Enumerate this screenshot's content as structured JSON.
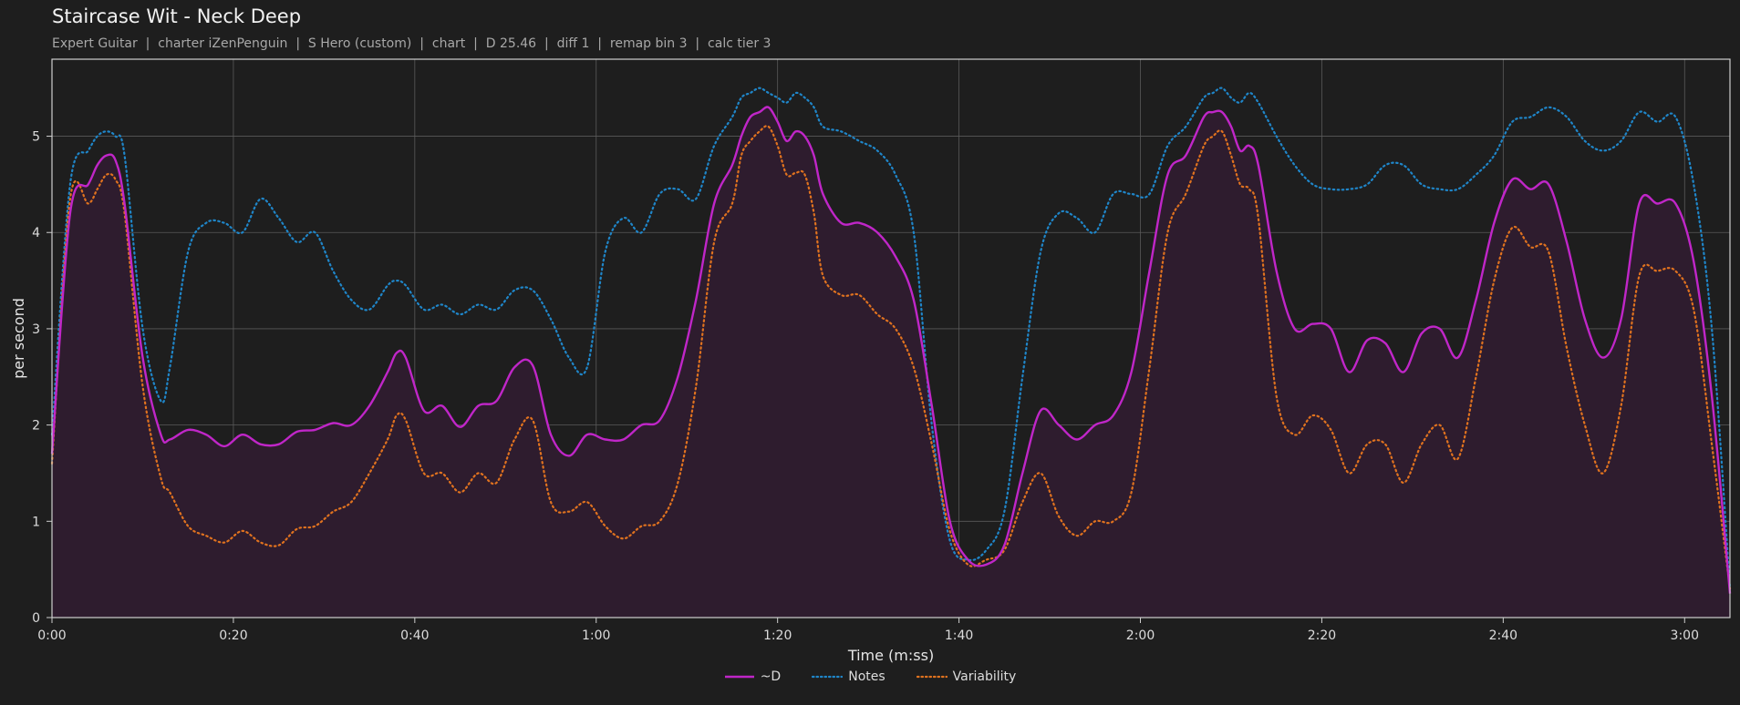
{
  "title": "Staircase Wit - Neck Deep",
  "subtitle": "Expert Guitar  |  charter iZenPenguin  |  S Hero (custom)  |  chart  |  D 25.46  |  diff 1  |  remap bin 3  |  calc tier 3",
  "colors": {
    "background": "#1e1e1e",
    "grid": "#5a5a5a",
    "axis": "#cfcfcf",
    "d": "#c026c8",
    "notes": "#1f86c9",
    "variability": "#e0721f",
    "fill": "#2e1c2e"
  },
  "chart_data": {
    "type": "line",
    "title": "Staircase Wit - Neck Deep",
    "xlabel": "Time (m:ss)",
    "ylabel": "per second",
    "xlim": [
      0,
      185
    ],
    "ylim": [
      0,
      5.8
    ],
    "x_ticks": [
      "0:00",
      "0:20",
      "0:40",
      "1:00",
      "1:20",
      "1:40",
      "2:00",
      "2:20",
      "2:40",
      "3:00"
    ],
    "y_ticks": [
      "0",
      "1",
      "2",
      "3",
      "4",
      "5"
    ],
    "grid": true,
    "legend_position": "bottom-center",
    "x": [
      0,
      2,
      4,
      5,
      6,
      7,
      8,
      10,
      12,
      13,
      15,
      17,
      19,
      21,
      23,
      25,
      27,
      29,
      31,
      33,
      35,
      37,
      38,
      39,
      41,
      43,
      45,
      47,
      49,
      51,
      53,
      55,
      57,
      59,
      61,
      63,
      65,
      67,
      69,
      71,
      73,
      75,
      76,
      77,
      78,
      79,
      80,
      81,
      82,
      83,
      84,
      85,
      87,
      89,
      91,
      93,
      95,
      97,
      99,
      101,
      103,
      105,
      107,
      109,
      111,
      113,
      115,
      117,
      119,
      121,
      123,
      125,
      127,
      128,
      129,
      130,
      131,
      132,
      133,
      135,
      137,
      139,
      141,
      143,
      145,
      147,
      149,
      151,
      153,
      155,
      157,
      159,
      161,
      163,
      165,
      167,
      169,
      171,
      173,
      175,
      177,
      179,
      181,
      183,
      185
    ],
    "series": [
      {
        "name": "~D",
        "style": "solid",
        "values": [
          1.7,
          4.2,
          4.5,
          4.7,
          4.8,
          4.75,
          4.3,
          2.7,
          1.9,
          1.85,
          1.95,
          1.9,
          1.78,
          1.9,
          1.8,
          1.8,
          1.93,
          1.95,
          2.02,
          2.0,
          2.2,
          2.55,
          2.75,
          2.7,
          2.15,
          2.2,
          1.98,
          2.2,
          2.25,
          2.6,
          2.62,
          1.9,
          1.68,
          1.9,
          1.85,
          1.85,
          2.0,
          2.05,
          2.5,
          3.3,
          4.3,
          4.7,
          5.0,
          5.2,
          5.25,
          5.3,
          5.15,
          4.95,
          5.05,
          5.0,
          4.8,
          4.4,
          4.1,
          4.1,
          4.0,
          3.75,
          3.3,
          2.2,
          1.0,
          0.6,
          0.55,
          0.75,
          1.5,
          2.15,
          2.0,
          1.85,
          2.0,
          2.1,
          2.55,
          3.6,
          4.6,
          4.8,
          5.2,
          5.25,
          5.25,
          5.1,
          4.85,
          4.9,
          4.7,
          3.6,
          3.0,
          3.05,
          3.0,
          2.55,
          2.88,
          2.85,
          2.55,
          2.95,
          3.0,
          2.7,
          3.3,
          4.1,
          4.55,
          4.45,
          4.5,
          3.9,
          3.1,
          2.7,
          3.1,
          4.3,
          4.3,
          4.3,
          3.7,
          2.3,
          0.25
        ]
      },
      {
        "name": "Notes",
        "style": "dotted",
        "values": [
          1.9,
          4.5,
          4.85,
          5.0,
          5.05,
          5.0,
          4.8,
          3.0,
          2.25,
          2.6,
          3.8,
          4.1,
          4.1,
          4.0,
          4.35,
          4.15,
          3.9,
          4.0,
          3.6,
          3.3,
          3.2,
          3.45,
          3.5,
          3.45,
          3.2,
          3.25,
          3.15,
          3.25,
          3.2,
          3.4,
          3.4,
          3.1,
          2.7,
          2.6,
          3.8,
          4.15,
          4.0,
          4.4,
          4.45,
          4.35,
          4.9,
          5.2,
          5.4,
          5.45,
          5.5,
          5.45,
          5.4,
          5.35,
          5.45,
          5.4,
          5.3,
          5.1,
          5.05,
          4.95,
          4.85,
          4.6,
          4.0,
          2.0,
          0.8,
          0.6,
          0.7,
          1.1,
          2.5,
          3.8,
          4.2,
          4.15,
          4.0,
          4.4,
          4.4,
          4.4,
          4.9,
          5.1,
          5.4,
          5.45,
          5.5,
          5.4,
          5.35,
          5.45,
          5.35,
          5.0,
          4.7,
          4.5,
          4.45,
          4.45,
          4.5,
          4.7,
          4.7,
          4.5,
          4.45,
          4.45,
          4.6,
          4.8,
          5.15,
          5.2,
          5.3,
          5.2,
          4.95,
          4.85,
          4.95,
          5.25,
          5.15,
          5.2,
          4.5,
          3.0,
          0.3
        ]
      },
      {
        "name": "Variability",
        "style": "dotted",
        "values": [
          1.6,
          4.35,
          4.3,
          4.45,
          4.6,
          4.55,
          4.2,
          2.4,
          1.45,
          1.3,
          0.95,
          0.85,
          0.78,
          0.9,
          0.78,
          0.75,
          0.92,
          0.95,
          1.1,
          1.2,
          1.5,
          1.85,
          2.1,
          2.05,
          1.5,
          1.5,
          1.3,
          1.5,
          1.4,
          1.85,
          2.05,
          1.2,
          1.1,
          1.2,
          0.95,
          0.82,
          0.95,
          1.0,
          1.4,
          2.4,
          3.9,
          4.3,
          4.8,
          4.95,
          5.05,
          5.1,
          4.9,
          4.6,
          4.62,
          4.6,
          4.2,
          3.55,
          3.35,
          3.35,
          3.15,
          3.0,
          2.6,
          1.8,
          0.9,
          0.55,
          0.6,
          0.7,
          1.2,
          1.5,
          1.05,
          0.85,
          1.0,
          1.0,
          1.3,
          2.6,
          4.0,
          4.4,
          4.9,
          5.0,
          5.05,
          4.8,
          4.5,
          4.45,
          4.15,
          2.3,
          1.9,
          2.1,
          1.95,
          1.5,
          1.8,
          1.8,
          1.4,
          1.8,
          2.0,
          1.65,
          2.5,
          3.5,
          4.05,
          3.85,
          3.8,
          2.8,
          2.0,
          1.5,
          2.2,
          3.55,
          3.6,
          3.6,
          3.2,
          1.8,
          0.3
        ]
      }
    ]
  }
}
